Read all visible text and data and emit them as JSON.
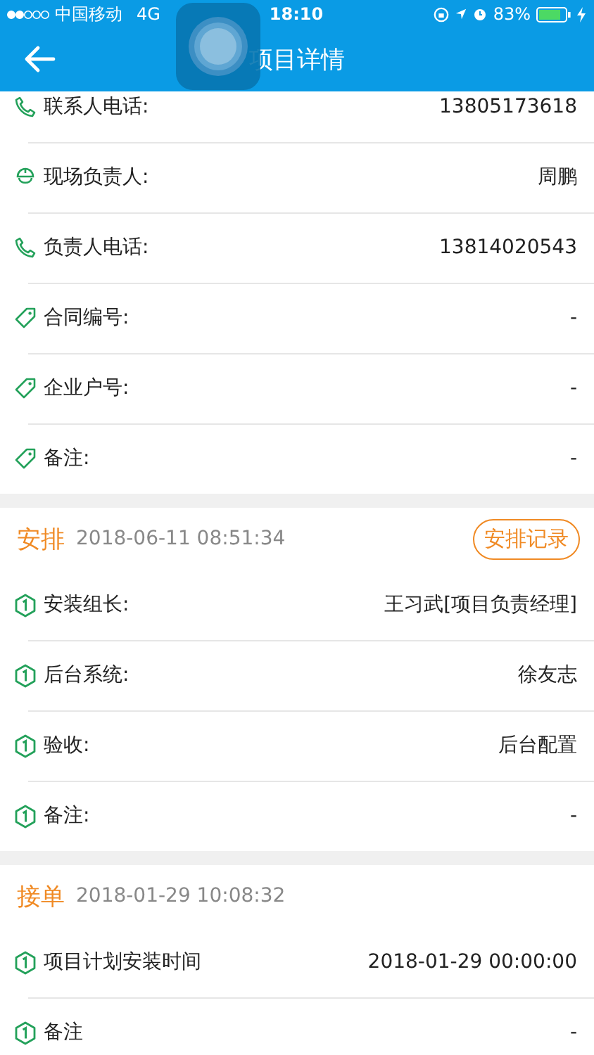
{
  "status_bar": {
    "carrier": "中国移动",
    "network": "4G",
    "time": "18:10",
    "battery": "83%"
  },
  "nav": {
    "title": "项目详情"
  },
  "info_rows": [
    {
      "kind": "phone",
      "label": "联系人电话:",
      "value": "13805173618"
    },
    {
      "kind": "worker",
      "label": "现场负责人:",
      "value": "周鹏"
    },
    {
      "kind": "phone",
      "label": "负责人电话:",
      "value": "13814020543"
    },
    {
      "kind": "tag",
      "label": "合同编号:",
      "value": "-"
    },
    {
      "kind": "tag",
      "label": "企业户号:",
      "value": "-"
    },
    {
      "kind": "tag",
      "label": "备注:",
      "value": "-"
    }
  ],
  "sections": [
    {
      "title": "安排",
      "time": "2018-06-11 08:51:34",
      "action": "安排记录",
      "rows": [
        {
          "label": "安装组长:",
          "value": "王习武[项目负责经理]"
        },
        {
          "label": "后台系统:",
          "value": "徐友志"
        },
        {
          "label": "验收:",
          "value": "后台配置"
        },
        {
          "label": "备注:",
          "value": "-"
        }
      ]
    },
    {
      "title": "接单",
      "time": "2018-01-29 10:08:32",
      "rows": [
        {
          "label": "项目计划安装时间",
          "value": "2018-01-29 00:00:00"
        },
        {
          "label": "备注",
          "value": "-"
        }
      ]
    }
  ]
}
